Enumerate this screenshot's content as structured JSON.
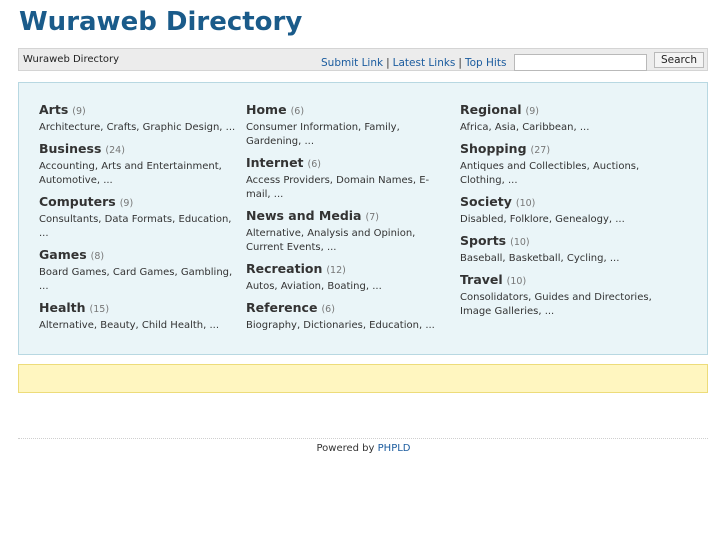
{
  "site": {
    "title": "Wuraweb Directory"
  },
  "nav": {
    "breadcrumb": "Wuraweb Directory",
    "links": [
      "Submit Link",
      "Latest Links",
      "Top Hits"
    ],
    "separator": "|",
    "search_value": "",
    "search_button": "Search"
  },
  "categories": {
    "col1": [
      {
        "name": "Arts",
        "count": "(9)",
        "subs": "Architecture, Crafts, Graphic Design, ..."
      },
      {
        "name": "Business",
        "count": "(24)",
        "subs": "Accounting, Arts and Entertainment, Automotive, ..."
      },
      {
        "name": "Computers",
        "count": "(9)",
        "subs": "Consultants, Data Formats, Education, ..."
      },
      {
        "name": "Games",
        "count": "(8)",
        "subs": "Board Games, Card Games, Gambling, ..."
      },
      {
        "name": "Health",
        "count": "(15)",
        "subs": "Alternative, Beauty, Child Health, ..."
      }
    ],
    "col2": [
      {
        "name": "Home",
        "count": "(6)",
        "subs": "Consumer Information, Family, Gardening, ..."
      },
      {
        "name": "Internet",
        "count": "(6)",
        "subs": "Access Providers, Domain Names, E-mail, ..."
      },
      {
        "name": "News and Media",
        "count": "(7)",
        "subs": "Alternative, Analysis and Opinion, Current Events, ..."
      },
      {
        "name": "Recreation",
        "count": "(12)",
        "subs": "Autos, Aviation, Boating, ..."
      },
      {
        "name": "Reference",
        "count": "(6)",
        "subs": "Biography, Dictionaries, Education, ..."
      }
    ],
    "col3": [
      {
        "name": "Regional",
        "count": "(9)",
        "subs": "Africa, Asia, Caribbean, ..."
      },
      {
        "name": "Shopping",
        "count": "(27)",
        "subs": "Antiques and Collectibles, Auctions, Clothing, ..."
      },
      {
        "name": "Society",
        "count": "(10)",
        "subs": "Disabled, Folklore, Genealogy, ..."
      },
      {
        "name": "Sports",
        "count": "(10)",
        "subs": "Baseball, Basketball, Cycling, ..."
      },
      {
        "name": "Travel",
        "count": "(10)",
        "subs": "Consolidators, Guides and Directories, Image Galleries, ..."
      }
    ]
  },
  "footer": {
    "powered_by": "Powered by",
    "link": "PHPLD"
  }
}
